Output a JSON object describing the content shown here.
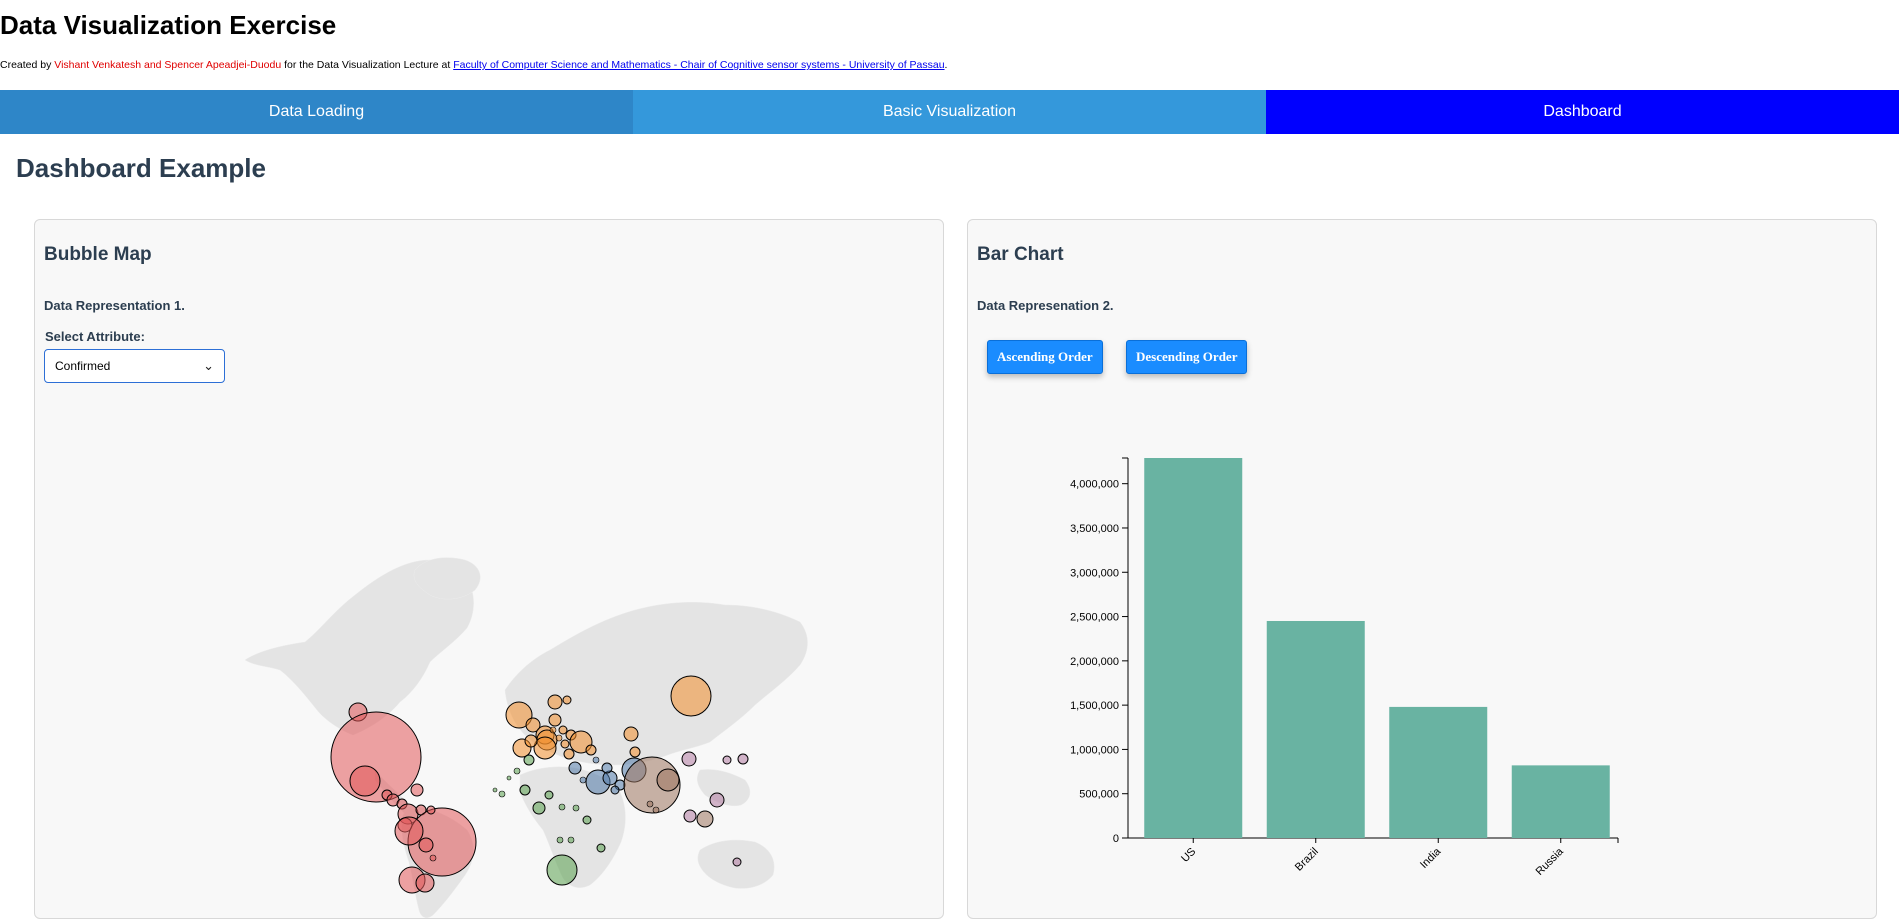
{
  "header": {
    "title": "Data Visualization Exercise",
    "credits_prefix": "Created by ",
    "credits_authors": "Vishant Venkatesh and Spencer Apeadjei-Duodu",
    "credits_middle": " for the Data Visualization Lecture at ",
    "credits_link": "Faculty of Computer Science and Mathematics - Chair of Cognitive sensor systems - University of Passau",
    "credits_suffix": "."
  },
  "tabs": [
    "Data Loading",
    "Basic Visualization",
    "Dashboard"
  ],
  "active_tab": "Dashboard",
  "section_title": "Dashboard Example",
  "bubble_panel": {
    "title": "Bubble Map",
    "subtitle": "Data Representation 1.",
    "select_label": "Select Attribute:",
    "selected_attribute": "Confirmed"
  },
  "bar_panel": {
    "title": "Bar Chart",
    "subtitle": "Data Represenation 2.",
    "ascending_label": "Ascending Order",
    "descending_label": "Descending Order"
  },
  "colors": {
    "tab_1": "#2e86c8",
    "tab_2": "#3498db",
    "tab_active": "#0000ff",
    "bar_fill": "#69b3a2",
    "button": "#1a8cff",
    "region_americas": "#e15759",
    "region_europe": "#f28e2b",
    "region_africa": "#59a14f",
    "region_middle_east": "#4e79a7",
    "region_south_asia": "#9c755f",
    "region_east_asia": "#b07aa1"
  },
  "chart_data": {
    "type": "bar",
    "categories": [
      "US",
      "Brazil",
      "India",
      "Russia"
    ],
    "values": [
      4290000,
      2450000,
      1480000,
      820000
    ],
    "title": "",
    "xlabel": "",
    "ylabel": "",
    "ylim": [
      0,
      4290000
    ],
    "yticks": [
      0,
      500000,
      1000000,
      1500000,
      2000000,
      2500000,
      3000000,
      3500000,
      4000000
    ],
    "ytick_labels": [
      "0",
      "500,000",
      "1,000,000",
      "1,500,000",
      "2,000,000",
      "2,500,000",
      "3,000,000",
      "3,500,000",
      "4,000,000"
    ],
    "grid": false
  }
}
